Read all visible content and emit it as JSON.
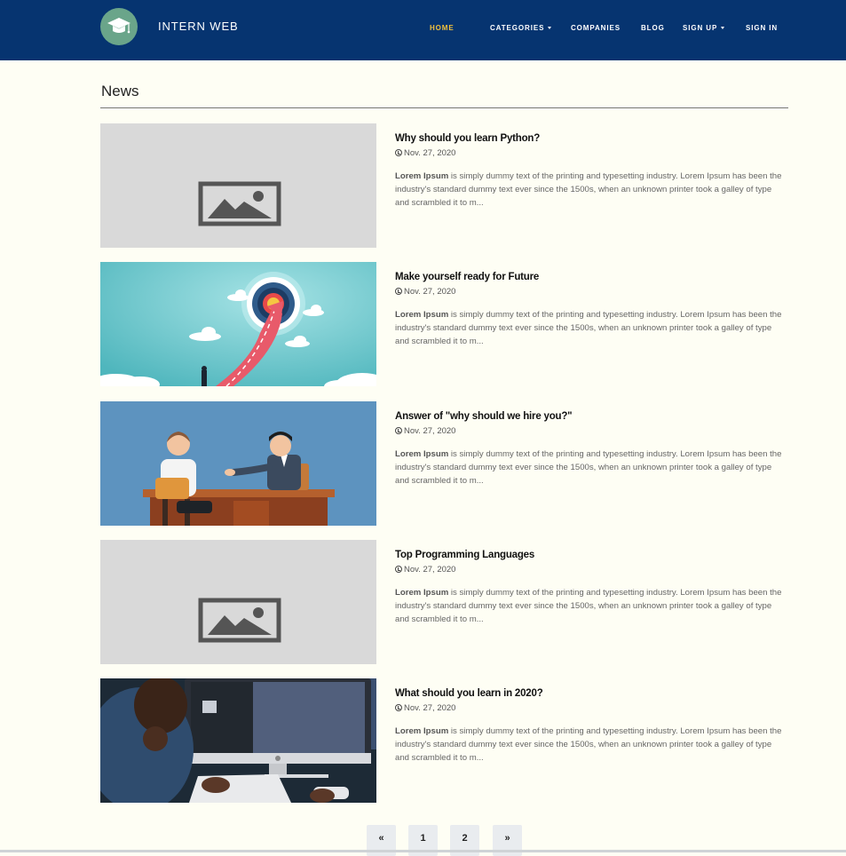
{
  "header": {
    "brand": "INTERN WEB",
    "logo_icon": "graduation-cap-icon",
    "colors": {
      "navbar": "#063470",
      "active": "#f0c03c",
      "logo_bg": "#6aa58a"
    },
    "nav": [
      {
        "label": "HOME",
        "active": true
      },
      {
        "label": "CATEGORIES",
        "dropdown": true
      },
      {
        "label": "COMPANIES"
      },
      {
        "label": "BLOG"
      },
      {
        "label": "SIGN UP",
        "dropdown": true
      },
      {
        "label": "SIGN IN"
      }
    ]
  },
  "main": {
    "section_title": "News",
    "excerpt_bold": "Lorem Ipsum",
    "excerpt_rest": " is simply dummy text of the printing and typesetting industry. Lorem Ipsum has been the industry's standard dummy text ever since the 1500s, when an unknown printer took a galley of type and scrambled it to m...",
    "posts": [
      {
        "title": "Why should you learn Python?",
        "date": "Nov. 27, 2020",
        "thumbnail": "image-placeholder-icon"
      },
      {
        "title": "Make yourself ready for Future",
        "date": "Nov. 27, 2020",
        "thumbnail": "target-road-illustration"
      },
      {
        "title": "Answer of \"why should we hire you?\"",
        "date": "Nov. 27, 2020",
        "thumbnail": "job-interview-illustration"
      },
      {
        "title": "Top Programming Languages",
        "date": "Nov. 27, 2020",
        "thumbnail": "image-placeholder-icon"
      },
      {
        "title": "What should you learn in 2020?",
        "date": "Nov. 27, 2020",
        "thumbnail": "person-at-computer-photo"
      }
    ]
  },
  "pagination": {
    "prev": "«",
    "pages": [
      "1",
      "2"
    ],
    "next": "»"
  }
}
